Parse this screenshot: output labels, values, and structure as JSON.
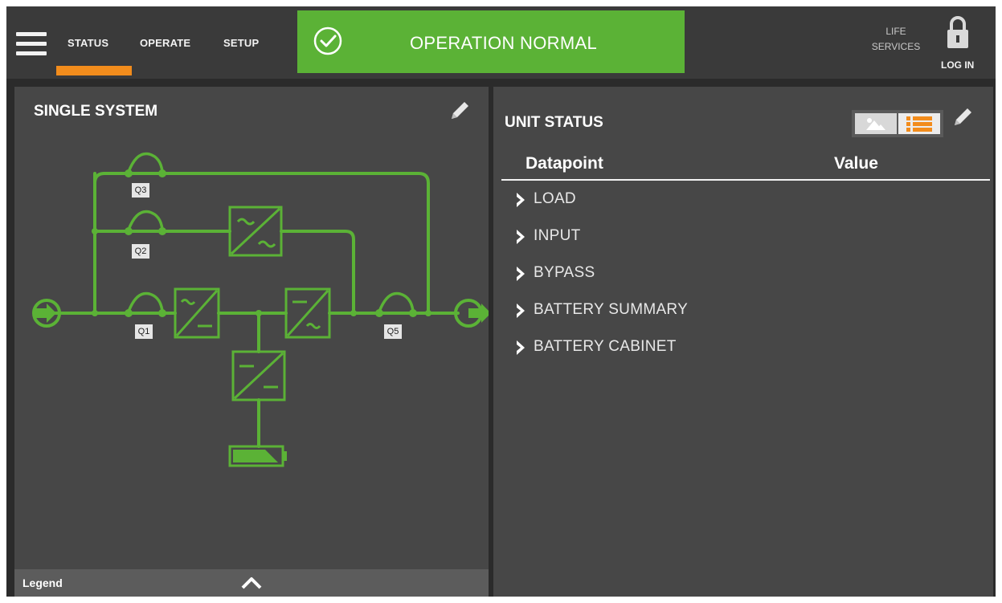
{
  "header": {
    "nav_tabs": [
      {
        "label": "STATUS",
        "active": true
      },
      {
        "label": "OPERATE",
        "active": false
      },
      {
        "label": "SETUP",
        "active": false
      }
    ],
    "banner": {
      "text": "OPERATION NORMAL",
      "color": "#5bb236"
    },
    "life_services": {
      "line1": "LIFE",
      "line2": "SERVICES"
    },
    "login_label": "LOG IN",
    "accent_color": "#f28c1c"
  },
  "left_panel": {
    "title": "SINGLE SYSTEM",
    "switches": {
      "q1": "Q1",
      "q2": "Q2",
      "q3": "Q3",
      "q5": "Q5"
    },
    "legend_label": "Legend"
  },
  "right_panel": {
    "title": "UNIT STATUS",
    "columns": {
      "datapoint": "Datapoint",
      "value": "Value"
    },
    "items": [
      {
        "label": "LOAD"
      },
      {
        "label": "INPUT"
      },
      {
        "label": "BYPASS"
      },
      {
        "label": "BATTERY SUMMARY"
      },
      {
        "label": "BATTERY CABINET"
      }
    ]
  },
  "icons": [
    "menu-icon",
    "check-circle-icon",
    "lock-icon",
    "pencil-icon",
    "image-view-icon",
    "list-view-icon",
    "chevron-right-icon",
    "chevron-up-icon",
    "battery-icon"
  ]
}
